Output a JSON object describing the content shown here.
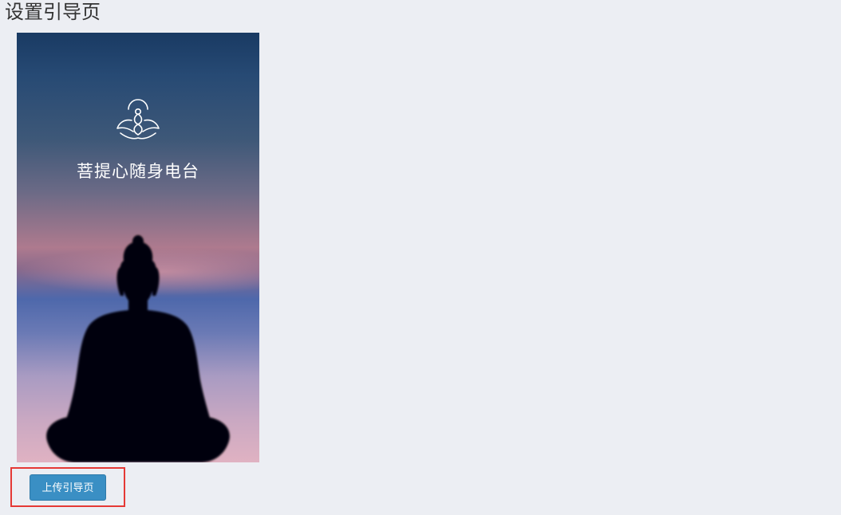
{
  "page": {
    "title": "设置引导页"
  },
  "splash": {
    "app_name": "菩提心随身电台",
    "logo_icon": "lotus-meditation-icon",
    "figure": "buddha-silhouette"
  },
  "actions": {
    "upload_label": "上传引导页",
    "highlight_color": "#e53935",
    "button_color": "#3a8fc4"
  }
}
